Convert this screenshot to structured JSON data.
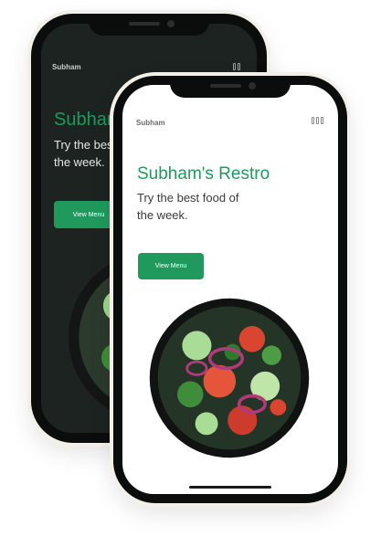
{
  "phones": {
    "back": {
      "theme": "dark",
      "brand": "Subham",
      "hero_title": "Subham's Restro",
      "hero_subtitle_line1": "Try the best food of",
      "hero_subtitle_line2": "the week.",
      "cta_label": "View Menu"
    },
    "front": {
      "theme": "light",
      "brand": "Subham",
      "hero_title": "Subham's Restro",
      "hero_subtitle_line1": "Try the best food of",
      "hero_subtitle_line2": "the week.",
      "cta_label": "View Menu"
    }
  },
  "icons": {
    "menu": "menu-grid-icon",
    "food": "salad-bowl-icon"
  },
  "colors": {
    "accent": "#1f9a5c",
    "dark_screen": "#1d2320",
    "light_screen": "#ffffff",
    "frame": "#0b0d0c"
  }
}
